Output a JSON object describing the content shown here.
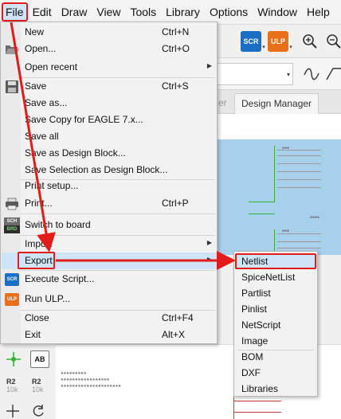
{
  "menubar": {
    "items": [
      "File",
      "Edit",
      "Draw",
      "View",
      "Tools",
      "Library",
      "Options",
      "Window",
      "Help"
    ]
  },
  "toolbar": {
    "scr_label": "SCR",
    "ulp_label": "ULP"
  },
  "tabs": {
    "design_manager": "Design Manager",
    "partial": "er"
  },
  "file_menu": {
    "items": [
      {
        "label": "New",
        "shortcut": "Ctrl+N"
      },
      {
        "label": "Open...",
        "shortcut": "Ctrl+O"
      },
      {
        "label": "Open recent",
        "shortcut": ""
      },
      {
        "label": "Save",
        "shortcut": "Ctrl+S"
      },
      {
        "label": "Save as...",
        "shortcut": ""
      },
      {
        "label": "Save Copy for EAGLE 7.x...",
        "shortcut": ""
      },
      {
        "label": "Save all",
        "shortcut": ""
      },
      {
        "label": "Save as Design Block...",
        "shortcut": ""
      },
      {
        "label": "Save Selection as Design Block...",
        "shortcut": ""
      },
      {
        "label": "Print setup...",
        "shortcut": ""
      },
      {
        "label": "Print...",
        "shortcut": "Ctrl+P"
      },
      {
        "label": "Switch to board",
        "shortcut": ""
      },
      {
        "label": "Import",
        "shortcut": ""
      },
      {
        "label": "Export",
        "shortcut": ""
      },
      {
        "label": "Execute Script...",
        "shortcut": ""
      },
      {
        "label": "Run ULP...",
        "shortcut": ""
      },
      {
        "label": "Close",
        "shortcut": "Ctrl+F4"
      },
      {
        "label": "Exit",
        "shortcut": "Alt+X"
      }
    ]
  },
  "export_submenu": {
    "items": [
      "Netlist",
      "SpiceNetList",
      "Partlist",
      "Pinlist",
      "NetScript",
      "Image",
      "BOM",
      "DXF",
      "Libraries"
    ]
  },
  "icons": {
    "sch_brd_top": "SCH",
    "sch_brd_bottom": "BRD",
    "scr": "SCR",
    "ulp": "ULP"
  },
  "left_tools": {
    "ab_label": "AB",
    "r2_label_1": "R2",
    "r2_value_1": "10k",
    "r2_label_2": "R2",
    "r2_value_2": "10k"
  },
  "colors": {
    "highlight": "#cfe4f7",
    "callout_red": "#e21b1b",
    "scr_icon": "#1a6fc2",
    "ulp_icon": "#e8701a"
  }
}
